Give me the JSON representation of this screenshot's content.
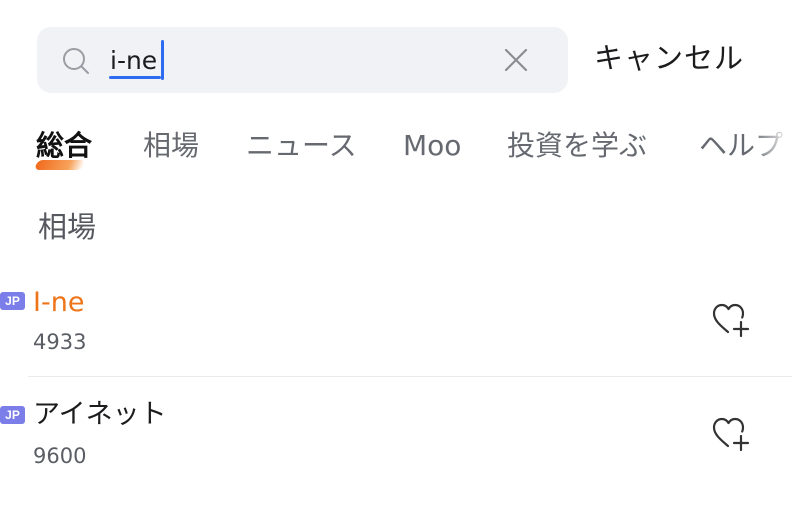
{
  "search": {
    "query": "i-ne",
    "cancel_label": "キャンセル"
  },
  "tabs": [
    {
      "label": "総合",
      "active": true
    },
    {
      "label": "相場",
      "active": false
    },
    {
      "label": "ニュース",
      "active": false
    },
    {
      "label": "Moo",
      "active": false
    },
    {
      "label": "投資を学ぶ",
      "active": false
    },
    {
      "label": "ヘルプ",
      "active": false
    }
  ],
  "section": {
    "title": "相場"
  },
  "results": [
    {
      "badge": "JP",
      "name": "I-ne",
      "code": "4933",
      "highlight": true,
      "icon": "heart-plus-icon"
    },
    {
      "badge": "JP",
      "name": "アイネット",
      "code": "9600",
      "highlight": false,
      "icon": "heart-plus-icon"
    }
  ],
  "colors": {
    "accent_orange": "#ee7419",
    "caret_blue": "#2d6cf0",
    "badge_purple": "#7b7ee8",
    "search_bg": "#f1f2f5"
  }
}
